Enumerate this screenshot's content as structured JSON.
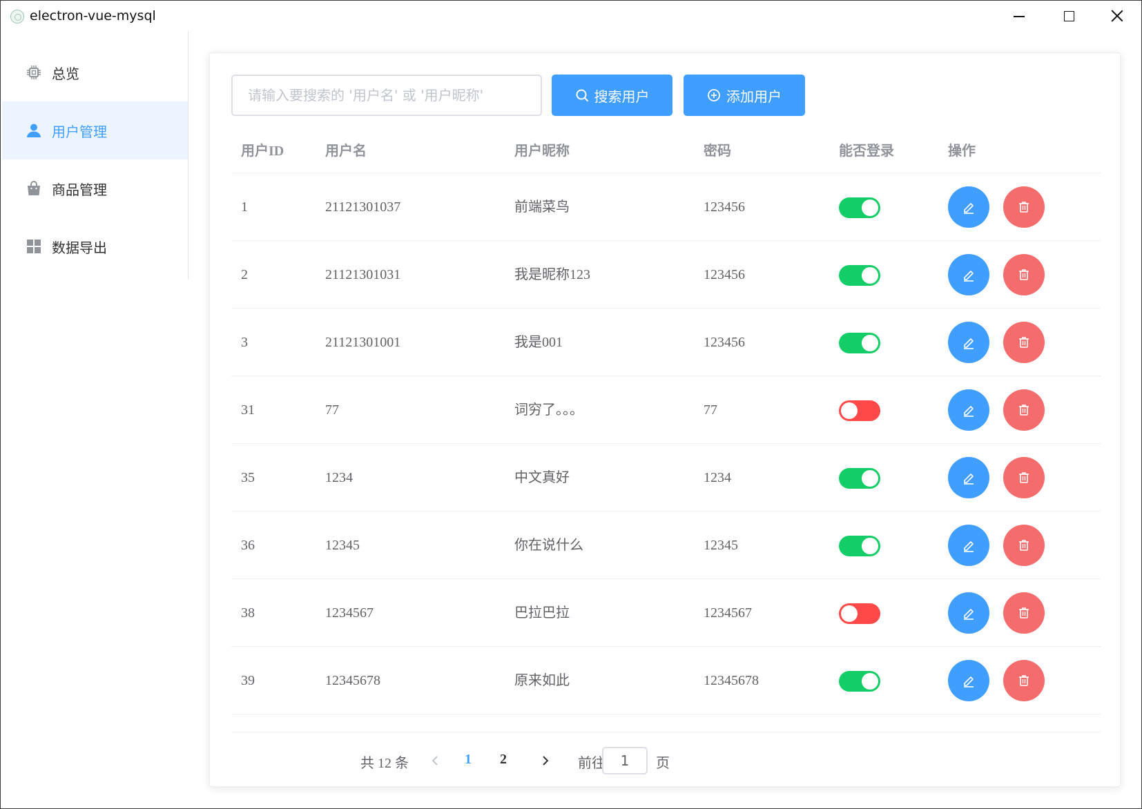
{
  "window": {
    "title": "electron-vue-mysql",
    "icon": "electron-icon",
    "controls": [
      "minimize-icon",
      "maximize-icon",
      "close-icon"
    ]
  },
  "sidebar": {
    "items": [
      {
        "label": "总览",
        "icon": "chip-icon",
        "active": false
      },
      {
        "label": "用户管理",
        "icon": "user-icon",
        "active": true
      },
      {
        "label": "商品管理",
        "icon": "shopping-bag-icon",
        "active": false
      },
      {
        "label": "数据导出",
        "icon": "grid-icon",
        "active": false
      }
    ]
  },
  "toolbar": {
    "search_placeholder": "请输入要搜索的 '用户名' 或 '用户昵称'",
    "search_value": "",
    "search_button": "搜索用户",
    "add_button": "添加用户"
  },
  "table": {
    "headers": {
      "id": "用户ID",
      "username": "用户名",
      "nickname": "用户昵称",
      "password": "密码",
      "can_login": "能否登录",
      "actions": "操作"
    },
    "rows": [
      {
        "id": "1",
        "username": "21121301037",
        "nickname": "前端菜鸟",
        "password": "123456",
        "can_login": true
      },
      {
        "id": "2",
        "username": "21121301031",
        "nickname": "我是昵称123",
        "password": "123456",
        "can_login": true
      },
      {
        "id": "3",
        "username": "21121301001",
        "nickname": "我是001",
        "password": "123456",
        "can_login": true
      },
      {
        "id": "31",
        "username": "77",
        "nickname": "词穷了。。。",
        "password": "77",
        "can_login": false
      },
      {
        "id": "35",
        "username": "1234",
        "nickname": "中文真好",
        "password": "1234",
        "can_login": true
      },
      {
        "id": "36",
        "username": "12345",
        "nickname": "你在说什么",
        "password": "12345",
        "can_login": true
      },
      {
        "id": "38",
        "username": "1234567",
        "nickname": "巴拉巴拉",
        "password": "1234567",
        "can_login": false
      },
      {
        "id": "39",
        "username": "12345678",
        "nickname": "原来如此",
        "password": "12345678",
        "can_login": true
      }
    ]
  },
  "pagination": {
    "total_text": "共 12 条",
    "pages": [
      "1",
      "2"
    ],
    "current_page": "1",
    "goto_label": "前往",
    "goto_value": "1",
    "page_suffix": "页"
  },
  "colors": {
    "primary": "#409eff",
    "danger": "#f56c6c",
    "switch_on": "#13ce66",
    "switch_off": "#ff4949",
    "active_menu_bg": "#ecf5ff"
  }
}
